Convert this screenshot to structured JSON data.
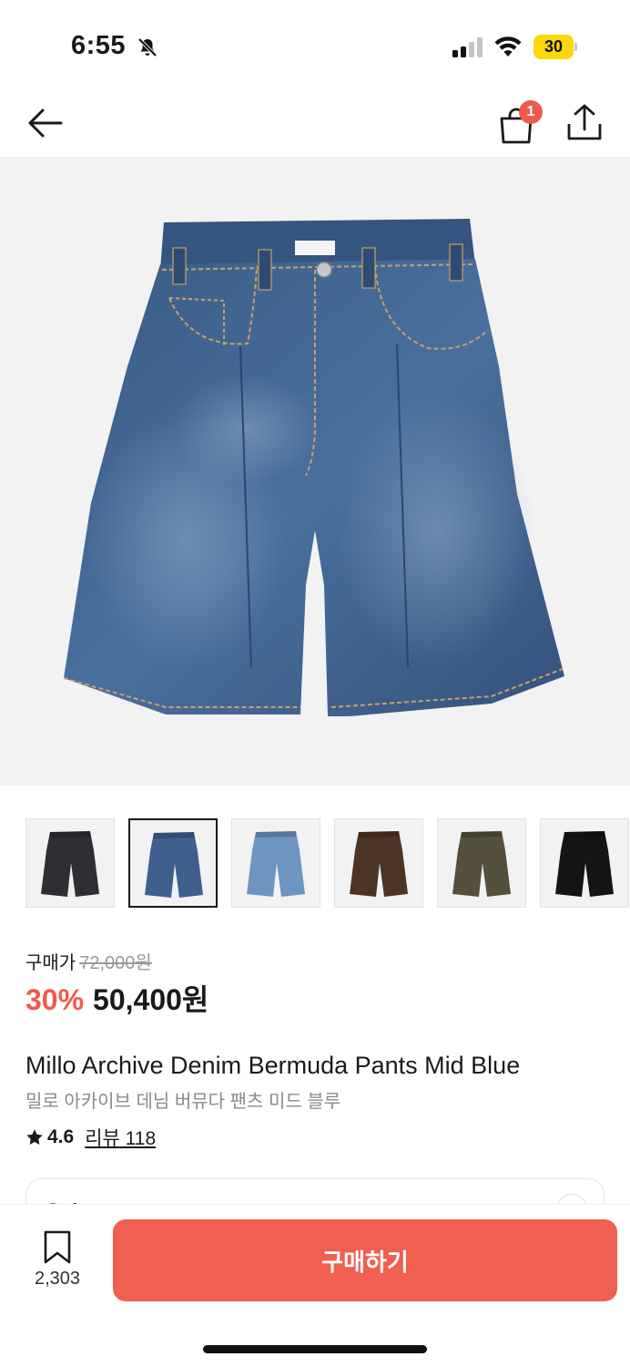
{
  "status_bar": {
    "time": "6:55",
    "battery": "30",
    "icons": [
      "bell-slash-icon",
      "cellular-signal-icon",
      "wifi-icon",
      "battery-icon"
    ]
  },
  "nav": {
    "back_icon": "arrow-left-icon",
    "bag_icon": "shopping-bag-icon",
    "bag_badge": "1",
    "share_icon": "share-icon"
  },
  "gallery": {
    "main_image": "denim-bermuda-shorts-mid-blue",
    "thumbnails": [
      {
        "color": "#2f2f33",
        "name": "black-washed-denim"
      },
      {
        "color": "#3f5f8f",
        "name": "mid-blue-denim"
      },
      {
        "color": "#6e94c2",
        "name": "light-blue-denim"
      },
      {
        "color": "#4a3424",
        "name": "brown"
      },
      {
        "color": "#55503c",
        "name": "olive-brown-washed"
      },
      {
        "color": "#141414",
        "name": "black"
      }
    ],
    "selected_index": 1
  },
  "price": {
    "label": "구매가",
    "original": "72,000원",
    "discount": "30%",
    "sale": "50,400원",
    "discount_color": "#f05a4b"
  },
  "product": {
    "name_en": "Millo Archive Denim Bermuda Pants Mid Blue",
    "name_ko": "밀로 아카이브 데님 버뮤다 팬츠 미드 블루",
    "rating_icon": "star-icon",
    "rating": "4.6",
    "review_label": "리뷰 118"
  },
  "options": {
    "label": "옵션"
  },
  "bottom_bar": {
    "wish_icon": "bookmark-icon",
    "wish_count": "2,303",
    "buy_label": "구매하기",
    "buy_color": "#f05f50"
  }
}
